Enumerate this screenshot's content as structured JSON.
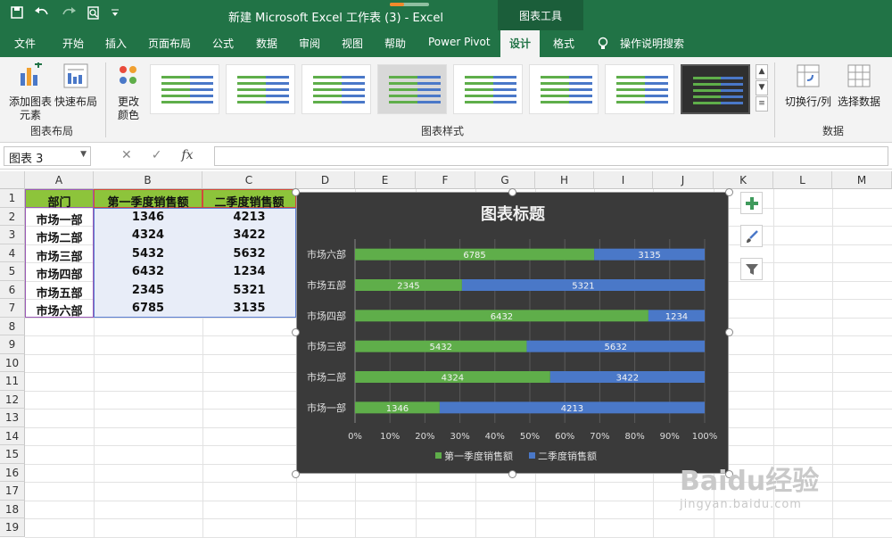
{
  "title_bar": {
    "document_title": "新建 Microsoft Excel 工作表 (3)  -  Excel",
    "context_tab": "图表工具",
    "qat_icons": [
      "save-icon",
      "undo-icon",
      "redo-icon",
      "print-preview-icon",
      "customize-icon"
    ]
  },
  "ribbon_tabs": [
    "文件",
    "开始",
    "插入",
    "页面布局",
    "公式",
    "数据",
    "审阅",
    "视图",
    "帮助",
    "Power Pivot",
    "设计",
    "格式",
    "操作说明搜索"
  ],
  "active_tab": "设计",
  "ribbon": {
    "layout_group": {
      "label": "图表布局",
      "add_element_line1": "添加图表",
      "add_element_line2": "元素",
      "quick_layout": "快速布局"
    },
    "change_colors_line1": "更改",
    "change_colors_line2": "颜色",
    "styles_group_label": "图表样式",
    "data_group": {
      "label": "数据",
      "switch_row_col": "切换行/列",
      "select_data": "选择数据"
    }
  },
  "formula_bar": {
    "name_box": "图表 3",
    "fx_label": "fx",
    "value": ""
  },
  "sheet": {
    "columns": [
      "A",
      "B",
      "C",
      "D",
      "E",
      "F",
      "G",
      "H",
      "I",
      "J",
      "K",
      "L",
      "M"
    ],
    "rows": [
      "1",
      "2",
      "3",
      "4",
      "5",
      "6",
      "7",
      "8",
      "9",
      "10",
      "11",
      "12",
      "13",
      "14",
      "15",
      "16",
      "17",
      "18",
      "19"
    ],
    "headers": [
      "部门",
      "第一季度销售额",
      "二季度销售额"
    ],
    "data": [
      [
        "市场一部",
        "1346",
        "4213"
      ],
      [
        "市场二部",
        "4324",
        "3422"
      ],
      [
        "市场三部",
        "5432",
        "5632"
      ],
      [
        "市场四部",
        "6432",
        "1234"
      ],
      [
        "市场五部",
        "2345",
        "5321"
      ],
      [
        "市场六部",
        "6785",
        "3135"
      ]
    ],
    "header_color": "#8dc43b"
  },
  "chart_data": {
    "type": "bar",
    "orientation": "horizontal",
    "stacked": "percent",
    "title": "图表标题",
    "categories": [
      "市场六部",
      "市场五部",
      "市场四部",
      "市场三部",
      "市场二部",
      "市场一部"
    ],
    "series": [
      {
        "name": "第一季度销售额",
        "values": [
          6785,
          2345,
          6432,
          5432,
          4324,
          1346
        ],
        "color": "#5fae4a"
      },
      {
        "name": "二季度销售额",
        "values": [
          3135,
          5321,
          1234,
          5632,
          3422,
          4213
        ],
        "color": "#4a78c8"
      }
    ],
    "x_ticks": [
      "0%",
      "10%",
      "20%",
      "30%",
      "40%",
      "50%",
      "60%",
      "70%",
      "80%",
      "90%",
      "100%"
    ],
    "xlim": [
      0,
      100
    ],
    "legend": "bottom",
    "background": "#3a3a3a"
  },
  "chart_side_tools": [
    "plus-icon",
    "brush-icon",
    "filter-icon"
  ],
  "watermark": {
    "logo_text": "Baidu经验",
    "url_text": "jingyan.baidu.com"
  }
}
